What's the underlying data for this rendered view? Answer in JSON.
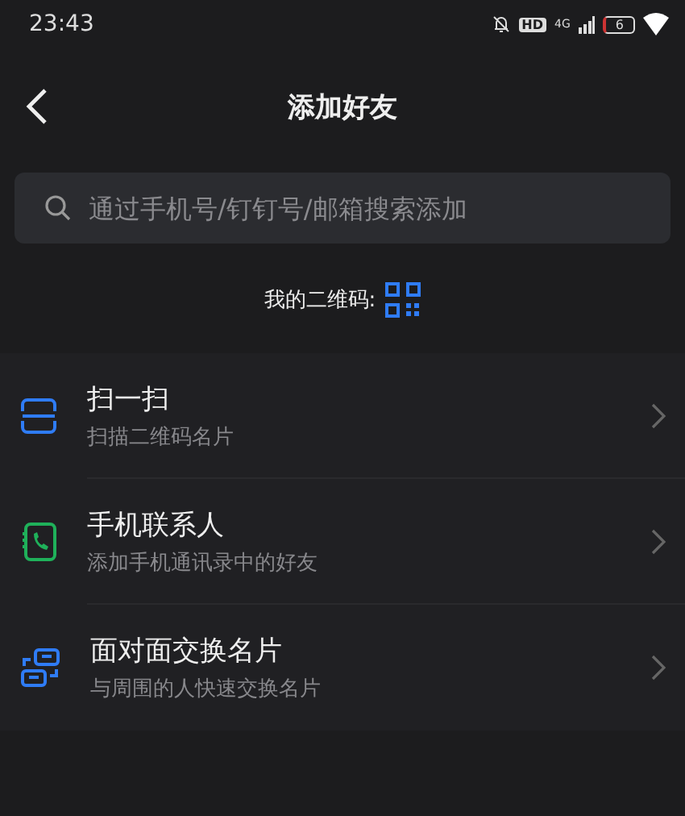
{
  "status_bar": {
    "time": "23:43",
    "hd": "HD",
    "network": "4G",
    "battery": "6"
  },
  "header": {
    "title": "添加好友"
  },
  "search": {
    "placeholder": "通过手机号/钉钉号/邮箱搜索添加"
  },
  "qr": {
    "label": "我的二维码:"
  },
  "items": [
    {
      "kind": "scan",
      "title": "扫一扫",
      "subtitle": "扫描二维码名片"
    },
    {
      "kind": "contacts",
      "title": "手机联系人",
      "subtitle": "添加手机通讯录中的好友"
    },
    {
      "kind": "exchange",
      "title": "面对面交换名片",
      "subtitle": "与周围的人快速交换名片"
    }
  ]
}
